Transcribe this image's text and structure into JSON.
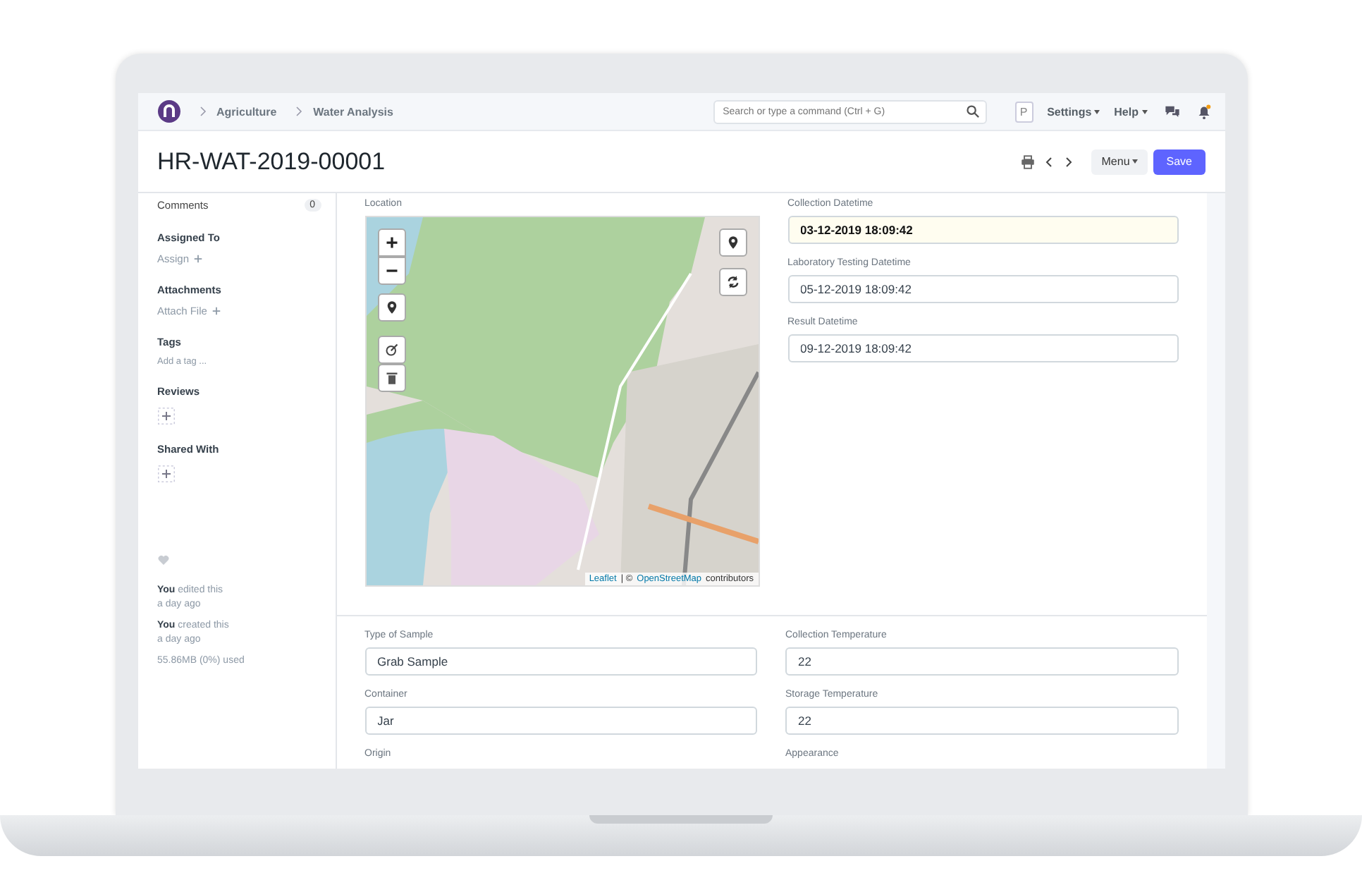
{
  "navbar": {
    "breadcrumbs": [
      "Agriculture",
      "Water Analysis"
    ],
    "search": {
      "placeholder": "Search or type a command (Ctrl + G)"
    },
    "avatar": "P",
    "menus": [
      "Settings",
      "Help"
    ]
  },
  "page": {
    "title": "HR-WAT-2019-00001",
    "menu_button": "Menu",
    "save_button": "Save"
  },
  "sidebar": {
    "comments": {
      "label": "Comments",
      "count": "0"
    },
    "sections": [
      {
        "kind": "link",
        "title": "Assigned To",
        "action": "Assign"
      },
      {
        "kind": "link",
        "title": "Attachments",
        "action": "Attach File"
      },
      {
        "kind": "tag",
        "title": "Tags",
        "action": "Add a tag ..."
      },
      {
        "kind": "add",
        "title": "Reviews"
      },
      {
        "kind": "add",
        "title": "Shared With"
      }
    ],
    "activity": [
      {
        "text": "**You** edited this",
        "time": "a day ago"
      },
      {
        "text": "**You** created this",
        "time": "a day ago"
      }
    ],
    "usage": "55.86MB (0%) used"
  },
  "form": {
    "location": {
      "label": "Location",
      "attribution_links": [
        "Leaflet",
        "OpenStreetMap"
      ],
      "attribution_separator": "| ©",
      "attribution_text": "contributors"
    },
    "datetimes": [
      {
        "label": "Collection Datetime",
        "value": "03-12-2019 18:09:42",
        "focused": true
      },
      {
        "label": "Laboratory Testing Datetime",
        "value": "05-12-2019 18:09:42",
        "focused": false
      },
      {
        "label": "Result Datetime",
        "value": "09-12-2019 18:09:42",
        "focused": false
      }
    ],
    "left_fields": [
      {
        "label": "Type of Sample",
        "value": "Grab Sample"
      },
      {
        "label": "Container",
        "value": "Jar"
      },
      {
        "label": "Origin"
      }
    ],
    "right_fields": [
      {
        "label": "Collection Temperature",
        "value": "22"
      },
      {
        "label": "Storage Temperature",
        "value": "22"
      },
      {
        "label": "Appearance"
      }
    ]
  }
}
